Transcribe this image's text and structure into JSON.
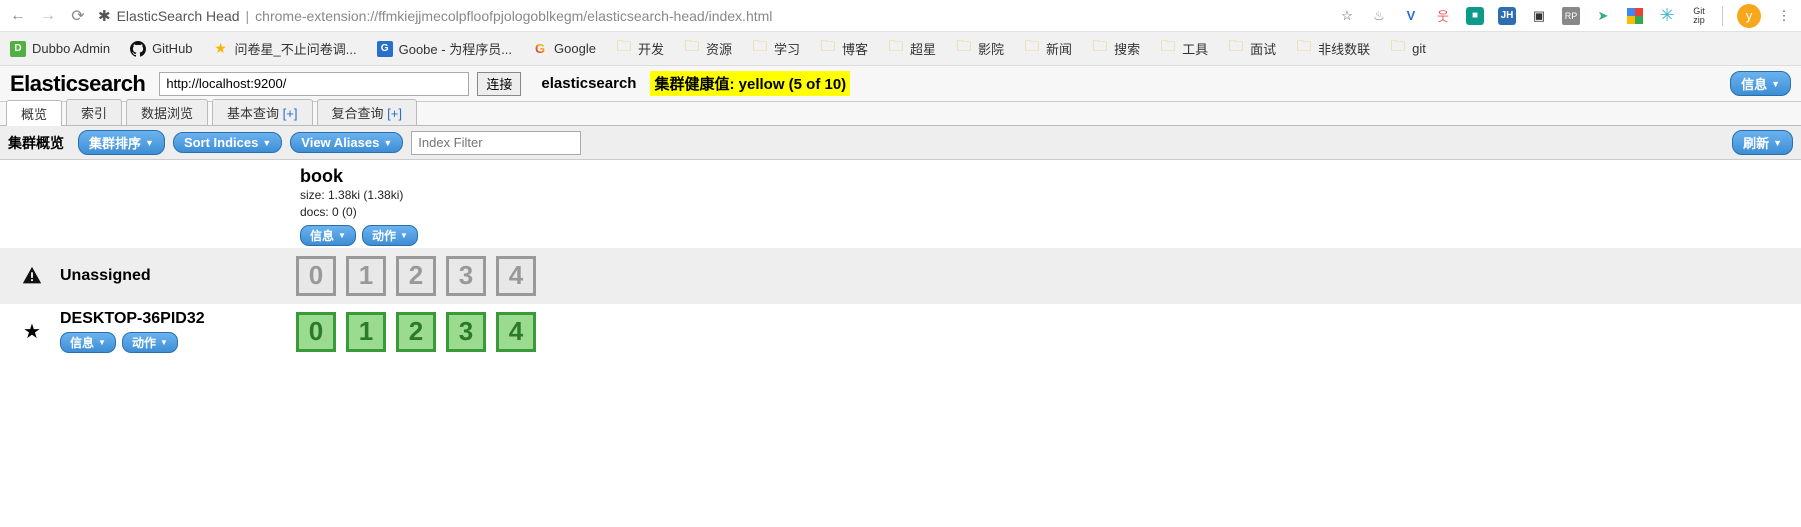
{
  "browser": {
    "title": "ElasticSearch Head",
    "url": "chrome-extension://ffmkiejjmecolpfloofpjologoblkegm/elasticsearch-head/index.html",
    "avatar_letter": "y"
  },
  "bookmarks": [
    {
      "icon": "green",
      "label": "Dubbo Admin"
    },
    {
      "icon": "github",
      "label": "GitHub"
    },
    {
      "icon": "star",
      "label": "问卷星_不止问卷调..."
    },
    {
      "icon": "blue",
      "label": "Goobe - 为程序员..."
    },
    {
      "icon": "google",
      "label": "Google"
    },
    {
      "icon": "folder",
      "label": "开发"
    },
    {
      "icon": "folder",
      "label": "资源"
    },
    {
      "icon": "folder",
      "label": "学习"
    },
    {
      "icon": "folder",
      "label": "博客"
    },
    {
      "icon": "folder",
      "label": "超星"
    },
    {
      "icon": "folder",
      "label": "影院"
    },
    {
      "icon": "folder",
      "label": "新闻"
    },
    {
      "icon": "folder",
      "label": "搜索"
    },
    {
      "icon": "folder",
      "label": "工具"
    },
    {
      "icon": "folder",
      "label": "面试"
    },
    {
      "icon": "folder",
      "label": "非线数联"
    },
    {
      "icon": "folder",
      "label": "git"
    }
  ],
  "header": {
    "logo": "Elasticsearch",
    "url_value": "http://localhost:9200/",
    "connect_label": "连接",
    "cluster_name": "elasticsearch",
    "health_text": "集群健康值: yellow (5 of 10)",
    "info_label": "信息"
  },
  "tabs": [
    {
      "label": "概览",
      "plus": false,
      "active": true
    },
    {
      "label": "索引",
      "plus": false,
      "active": false
    },
    {
      "label": "数据浏览",
      "plus": false,
      "active": false
    },
    {
      "label": "基本查询",
      "plus": true,
      "active": false
    },
    {
      "label": "复合查询",
      "plus": true,
      "active": false
    }
  ],
  "toolbar": {
    "overview_label": "集群概览",
    "sort_cluster": "集群排序",
    "sort_indices": "Sort Indices",
    "view_aliases": "View Aliases",
    "filter_placeholder": "Index Filter",
    "refresh_label": "刷新"
  },
  "index": {
    "name": "book",
    "size_line": "size: 1.38ki (1.38ki)",
    "docs_line": "docs: 0 (0)",
    "info_label": "信息",
    "action_label": "动作"
  },
  "nodes": {
    "unassigned": {
      "name": "Unassigned",
      "shards": [
        "0",
        "1",
        "2",
        "3",
        "4"
      ]
    },
    "primary": {
      "name": "DESKTOP-36PID32",
      "info_label": "信息",
      "action_label": "动作",
      "shards": [
        "0",
        "1",
        "2",
        "3",
        "4"
      ]
    }
  }
}
